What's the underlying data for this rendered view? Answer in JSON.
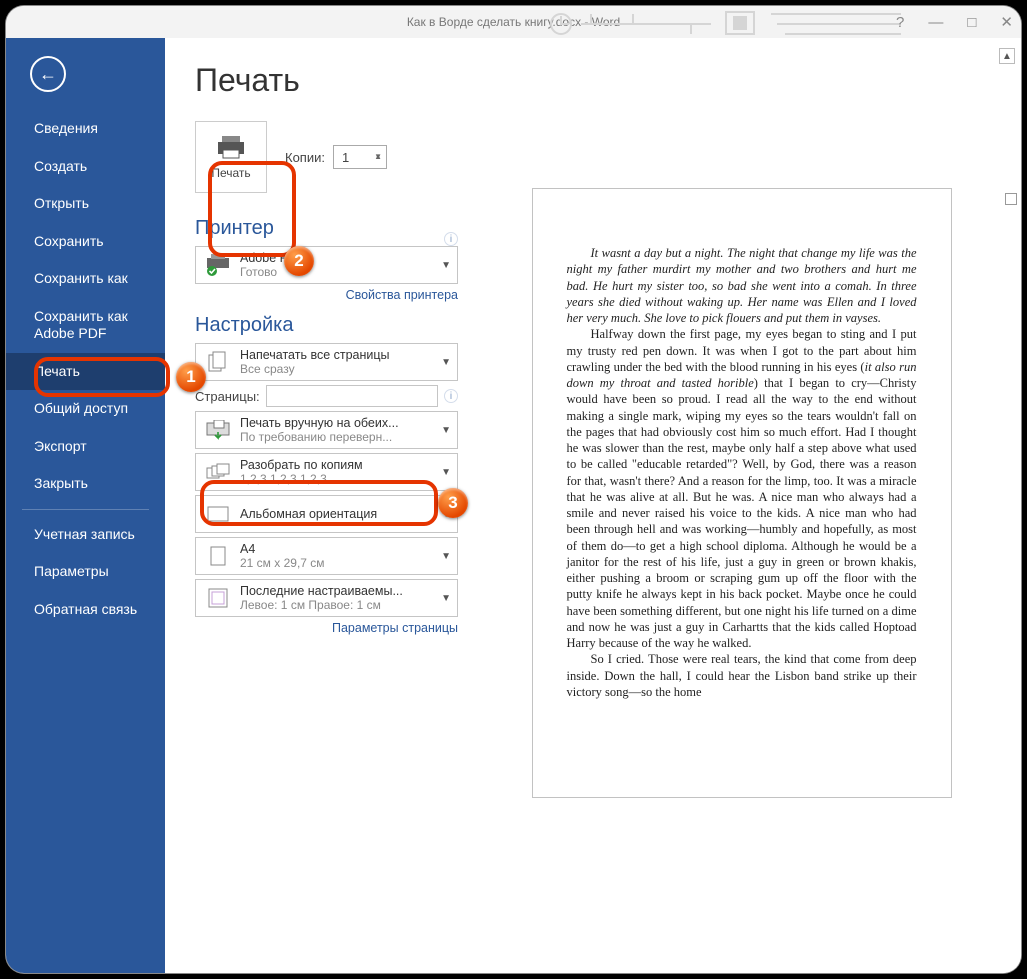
{
  "window": {
    "title": "Как в Ворде сделать книгу.docx - Word",
    "help": "?",
    "minimize": "—",
    "restore": "□",
    "close": "✕"
  },
  "sidebar": {
    "back": "←",
    "items": [
      {
        "label": "Сведения"
      },
      {
        "label": "Создать"
      },
      {
        "label": "Открыть"
      },
      {
        "label": "Сохранить"
      },
      {
        "label": "Сохранить как"
      },
      {
        "label": "Сохранить как Adobe PDF"
      },
      {
        "label": "Печать"
      },
      {
        "label": "Общий доступ"
      },
      {
        "label": "Экспорт"
      },
      {
        "label": "Закрыть"
      }
    ],
    "bottom": [
      {
        "label": "Учетная запись"
      },
      {
        "label": "Параметры"
      },
      {
        "label": "Обратная связь"
      }
    ]
  },
  "print": {
    "heading": "Печать",
    "button_label": "Печать",
    "copies_label": "Копии:",
    "copies_value": "1",
    "printer_heading": "Принтер",
    "printer": {
      "name": "Adobe PDF",
      "status": "Готово"
    },
    "printer_props": "Свойства принтера",
    "settings_heading": "Настройка",
    "pages_label": "Страницы:",
    "page_setup": "Параметры страницы",
    "options": {
      "range": {
        "l1": "Напечатать все страницы",
        "l2": "Все сразу"
      },
      "sides": {
        "l1": "Печать вручную на обеих...",
        "l2": "По требованию переверн..."
      },
      "collate": {
        "l1": "Разобрать по копиям",
        "l2": "1,2,3   1,2,3   1,2,3"
      },
      "orient": {
        "l1": "Альбомная ориентация",
        "l2": ""
      },
      "paper": {
        "l1": "A4",
        "l2": "21 см x 29,7 см"
      },
      "margins": {
        "l1": "Последние настраиваемы...",
        "l2": "Левое: 1 см  Правое: 1 см"
      }
    }
  },
  "callouts": {
    "n1": "1",
    "n2": "2",
    "n3": "3"
  },
  "doc": {
    "p1a": "It wasnt a day but a night. The night that change my life was the night my father murdirt my mother and two brothers and hurt me bad. He hurt my sister too, so bad she went into a comah. In three years she died without waking up. Her name was Ellen and I loved her very much. She love to pick flouers and put them in vayses.",
    "p2a": "Halfway down the first page, my eyes began to sting and I put my trusty red pen down. It was when I got to the part about him crawling under the bed with the blood running in his eyes (",
    "p2b": "it also run down my throat and tasted horible",
    "p2c": ") that I began to cry—Christy would have been so proud. I read all the way to the end without making a single mark, wiping my eyes so the tears wouldn't fall on the pages that had obviously cost him so much effort. Had I thought he was slower than the rest, maybe only half a step above what used to be called \"educable retarded\"? Well, by God, there was a reason for that, wasn't there? And a reason for the limp, too. It was a miracle that he was alive at all. But he was. A nice man who always had a smile and never raised his voice to the kids. A nice man who had been through hell and was working—humbly and hopefully, as most of them do—to get a high school diploma. Although he would be a janitor for the rest of his life, just a guy in green or brown khakis, either pushing a broom or scraping gum up off the floor with the putty knife he always kept in his back pocket. Maybe once he could have been something different, but one night his life turned on a dime and now he was just a guy in Carhartts that the kids called Hoptoad Harry because of the way he walked.",
    "p3": "So I cried. Those were real tears, the kind that come from deep inside. Down the hall, I could hear the Lisbon band strike up their victory song—so the home"
  }
}
